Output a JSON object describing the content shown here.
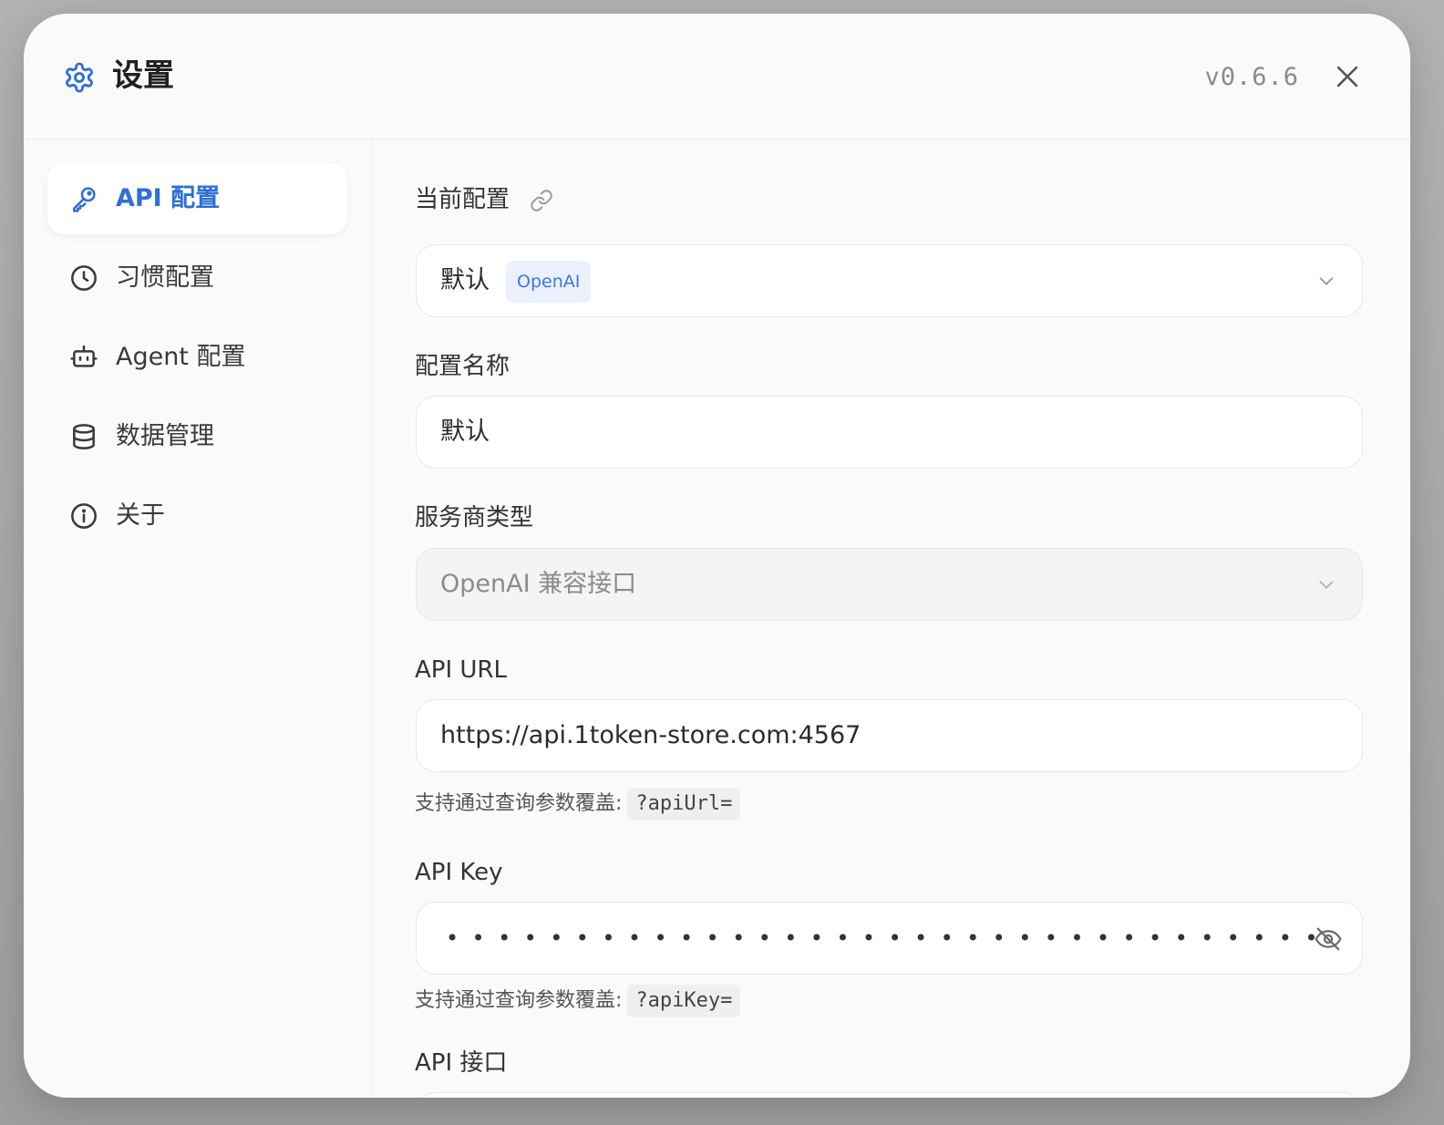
{
  "header": {
    "title": "设置",
    "version": "v0.6.6",
    "icon": "gear-icon",
    "close_icon": "close-icon"
  },
  "sidebar": {
    "items": [
      {
        "label": "API 配置",
        "icon": "key-icon",
        "active": true
      },
      {
        "label": "习惯配置",
        "icon": "clock-icon",
        "active": false
      },
      {
        "label": "Agent 配置",
        "icon": "robot-icon",
        "active": false
      },
      {
        "label": "数据管理",
        "icon": "database-icon",
        "active": false
      },
      {
        "label": "关于",
        "icon": "info-icon",
        "active": false
      }
    ]
  },
  "form": {
    "current_config": {
      "label": "当前配置",
      "value": "默认",
      "badge": "OpenAI"
    },
    "config_name": {
      "label": "配置名称",
      "value": "默认"
    },
    "provider_type": {
      "label": "服务商类型",
      "value": "OpenAI 兼容接口"
    },
    "api_url": {
      "label": "API URL",
      "value": "https://api.1token-store.com:4567",
      "hint_text": "支持通过查询参数覆盖:",
      "hint_code": "?apiUrl="
    },
    "api_key": {
      "label": "API Key",
      "masked_value": "••••••••••••••••••••••••••••••••••",
      "hint_text": "支持通过查询参数覆盖:",
      "hint_code": "?apiKey="
    },
    "api_endpoint": {
      "label": "API 接口"
    }
  },
  "colors": {
    "accent": "#2e6fd8",
    "badge_bg": "#eaf1fd",
    "dialog_bg": "#fafafa"
  }
}
